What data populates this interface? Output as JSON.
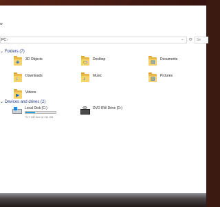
{
  "window": {
    "ribbon_label": "w"
  },
  "address": {
    "path": "PC",
    "chevron": "›",
    "dropdown_icon": "chevron-down-icon",
    "refresh_icon": "refresh-icon",
    "search_placeholder": "Se"
  },
  "folders_section": {
    "title": "Folders (7)",
    "items": [
      {
        "label": "3D Objects",
        "icon": "3d-objects-folder-icon",
        "overlay": "◈"
      },
      {
        "label": "Desktop",
        "icon": "desktop-folder-icon",
        "overlay": "▭"
      },
      {
        "label": "Documents",
        "icon": "documents-folder-icon",
        "overlay": "▤"
      },
      {
        "label": "Downloads",
        "icon": "downloads-folder-icon",
        "overlay": "↓"
      },
      {
        "label": "Music",
        "icon": "music-folder-icon",
        "overlay": "♪"
      },
      {
        "label": "Pictures",
        "icon": "pictures-folder-icon",
        "overlay": "▨"
      },
      {
        "label": "Videos",
        "icon": "videos-folder-icon",
        "overlay": "▶"
      }
    ]
  },
  "drives_section": {
    "title": "Devices and drives (2)",
    "items": [
      {
        "label": "Local Disk (C:)",
        "free_text": "75.7 GB free of 111 GB",
        "used_fraction": 0.32
      },
      {
        "label": "DVD RW Drive (D:)"
      }
    ]
  },
  "colors": {
    "section_header": "#1f3a93",
    "usage_fill": "#26a0da",
    "folder_yellow": "#f7d36b"
  }
}
